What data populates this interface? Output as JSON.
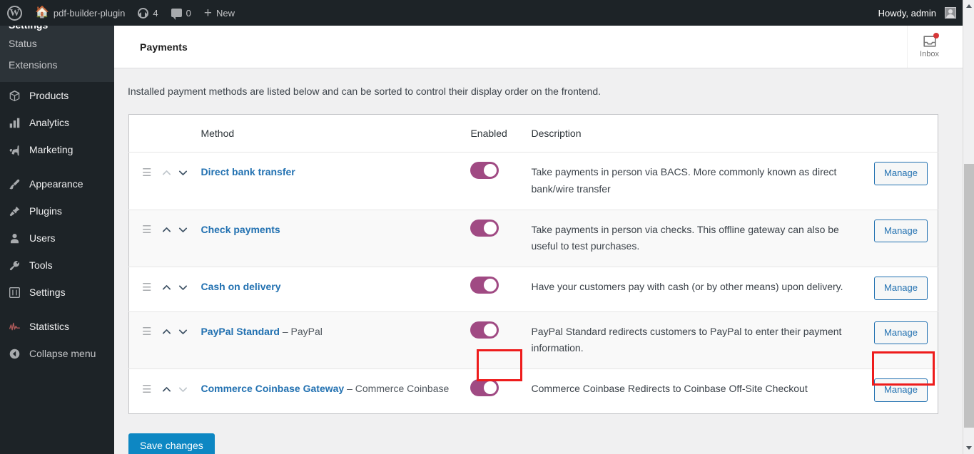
{
  "adminbar": {
    "wp_logo": "wordpress-logo",
    "site_name": "pdf-builder-plugin",
    "updates_count": "4",
    "comments_count": "0",
    "new_label": "New",
    "howdy": "Howdy, admin"
  },
  "sidebar": {
    "submenu_heading": "Settings",
    "submenu_items": [
      {
        "label": "Status"
      },
      {
        "label": "Extensions"
      }
    ],
    "items": [
      {
        "label": "Products",
        "icon": "products-box-icon"
      },
      {
        "label": "Analytics",
        "icon": "analytics-bars-icon"
      },
      {
        "label": "Marketing",
        "icon": "marketing-megaphone-icon"
      },
      {
        "label": "Appearance",
        "icon": "appearance-brush-icon"
      },
      {
        "label": "Plugins",
        "icon": "plugins-plug-icon"
      },
      {
        "label": "Users",
        "icon": "users-person-icon"
      },
      {
        "label": "Tools",
        "icon": "tools-wrench-icon"
      },
      {
        "label": "Settings",
        "icon": "settings-sliders-icon"
      },
      {
        "label": "Statistics",
        "icon": "statistics-pulse-icon"
      },
      {
        "label": "Collapse menu",
        "icon": "collapse-arrow-icon"
      }
    ]
  },
  "header": {
    "title": "Payments",
    "inbox_label": "Inbox",
    "inbox_icon": "inbox-tray-icon",
    "inbox_has_notification": true
  },
  "main": {
    "intro": "Installed payment methods are listed below and can be sorted to control their display order on the frontend.",
    "save_label": "Save changes",
    "columns": {
      "sort": "",
      "method": "Method",
      "enabled": "Enabled",
      "description": "Description",
      "action": ""
    },
    "rows": [
      {
        "name": "Direct bank transfer",
        "sub": "",
        "enabled": true,
        "description": "Take payments in person via BACS. More commonly known as direct bank/wire transfer",
        "action_label": "Manage",
        "up_disabled": true,
        "down_disabled": false
      },
      {
        "name": "Check payments",
        "sub": "",
        "enabled": true,
        "description": "Take payments in person via checks. This offline gateway can also be useful to test purchases.",
        "action_label": "Manage",
        "up_disabled": false,
        "down_disabled": false
      },
      {
        "name": "Cash on delivery",
        "sub": "",
        "enabled": true,
        "description": "Have your customers pay with cash (or by other means) upon delivery.",
        "action_label": "Manage",
        "up_disabled": false,
        "down_disabled": false
      },
      {
        "name": "PayPal Standard",
        "sub": "– PayPal",
        "enabled": true,
        "description": "PayPal Standard redirects customers to PayPal to enter their payment information.",
        "action_label": "Manage",
        "up_disabled": false,
        "down_disabled": false
      },
      {
        "name": "Commerce Coinbase Gateway",
        "sub": "– Commerce Coinbase",
        "enabled": true,
        "description": "Commerce Coinbase Redirects to Coinbase Off-Site Checkout",
        "action_label": "Manage",
        "up_disabled": false,
        "down_disabled": true
      }
    ]
  },
  "colors": {
    "toggle_on": "#a04a83",
    "link": "#2271b1",
    "save_button": "#0d87c3",
    "highlight": "#ee1c1c",
    "admin_bg": "#1d2327",
    "notification_dot": "#d63638"
  },
  "scrollbar": {
    "up_icon": "scroll-up-arrow-icon",
    "down_icon": "scroll-down-arrow-icon"
  }
}
